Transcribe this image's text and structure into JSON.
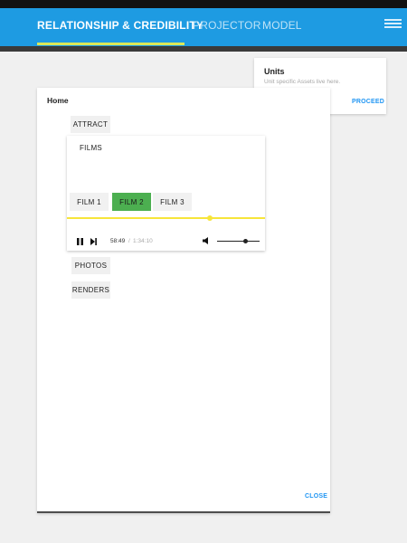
{
  "header": {
    "tabs": [
      {
        "label": "RELATIONSHIP & CREDIBILITY",
        "active": true
      },
      {
        "label": "PROJECTOR",
        "active": false
      },
      {
        "label": "MODEL",
        "active": false
      }
    ],
    "menu_icon": "hamburger-icon",
    "colors": {
      "bar": "#1e9be2",
      "underline": "#d9e85a"
    }
  },
  "units_card": {
    "title": "Units",
    "subtitle": "Unit specific Assets live here.",
    "action": "PROCEED"
  },
  "home": {
    "title": "Home",
    "chips": {
      "attract": "ATTRACT",
      "photos": "PHOTOS",
      "renders": "RENDERS"
    },
    "films": {
      "label": "FILMS",
      "tabs": [
        "FILM 1",
        "FILM 2",
        "FILM 3"
      ],
      "selected_tab": "FILM 2",
      "player": {
        "current_time": "58:49",
        "separator": "/",
        "total_time": "1:34:10",
        "progress_fraction": 0.72,
        "volume_fraction": 0.68,
        "icons": [
          "pause-icon",
          "skip-next-icon",
          "volume-icon"
        ],
        "accent_color": "#f7e53a"
      }
    },
    "close_label": "CLOSE"
  }
}
